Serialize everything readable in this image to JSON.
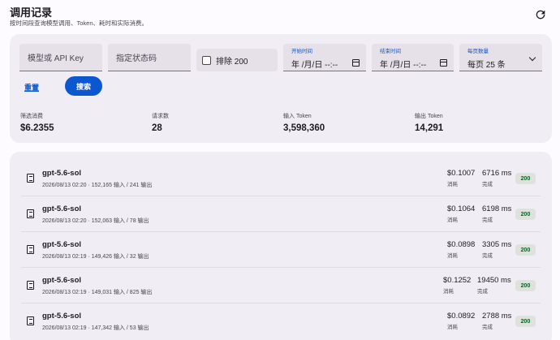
{
  "header": {
    "title": "调用记录",
    "subtitle": "按时间段查询模型调用、Token、耗时和实际消费。"
  },
  "filters": {
    "model_placeholder": "模型或 API Key",
    "status_placeholder": "指定状态码",
    "exclude_label": "排除 200",
    "start_label": "开始时间",
    "start_value": "年 /月/日 --:--",
    "end_label": "结束时间",
    "end_value": "年 /月/日 --:--",
    "page_size_label": "每页数量",
    "page_size_value": "每页 25 条",
    "reset_label": "重置",
    "search_label": "搜索"
  },
  "stats": [
    {
      "label": "筛选消费",
      "value": "$6.2355"
    },
    {
      "label": "请求数",
      "value": "28"
    },
    {
      "label": "输入 Token",
      "value": "3,598,360"
    },
    {
      "label": "输出 Token",
      "value": "14,291"
    }
  ],
  "records": [
    {
      "model": "gpt-5.6-sol",
      "meta": "2026/08/13 02:20 · 152,165 输入 / 241 输出",
      "cost": "$0.1007",
      "cost_label": "消耗",
      "duration": "6716 ms",
      "duration_label": "完成",
      "status": "200"
    },
    {
      "model": "gpt-5.6-sol",
      "meta": "2026/08/13 02:20 · 152,063 输入 / 78 输出",
      "cost": "$0.1064",
      "cost_label": "消耗",
      "duration": "6198 ms",
      "duration_label": "完成",
      "status": "200"
    },
    {
      "model": "gpt-5.6-sol",
      "meta": "2026/08/13 02:19 · 149,426 输入 / 32 输出",
      "cost": "$0.0898",
      "cost_label": "消耗",
      "duration": "3305 ms",
      "duration_label": "完成",
      "status": "200"
    },
    {
      "model": "gpt-5.6-sol",
      "meta": "2026/08/13 02:19 · 149,031 输入 / 825 输出",
      "cost": "$0.1252",
      "cost_label": "消耗",
      "duration": "19450 ms",
      "duration_label": "完成",
      "status": "200"
    },
    {
      "model": "gpt-5.6-sol",
      "meta": "2026/08/13 02:19 · 147,342 输入 / 53 输出",
      "cost": "$0.0892",
      "cost_label": "消耗",
      "duration": "2788 ms",
      "duration_label": "完成",
      "status": "200"
    }
  ]
}
